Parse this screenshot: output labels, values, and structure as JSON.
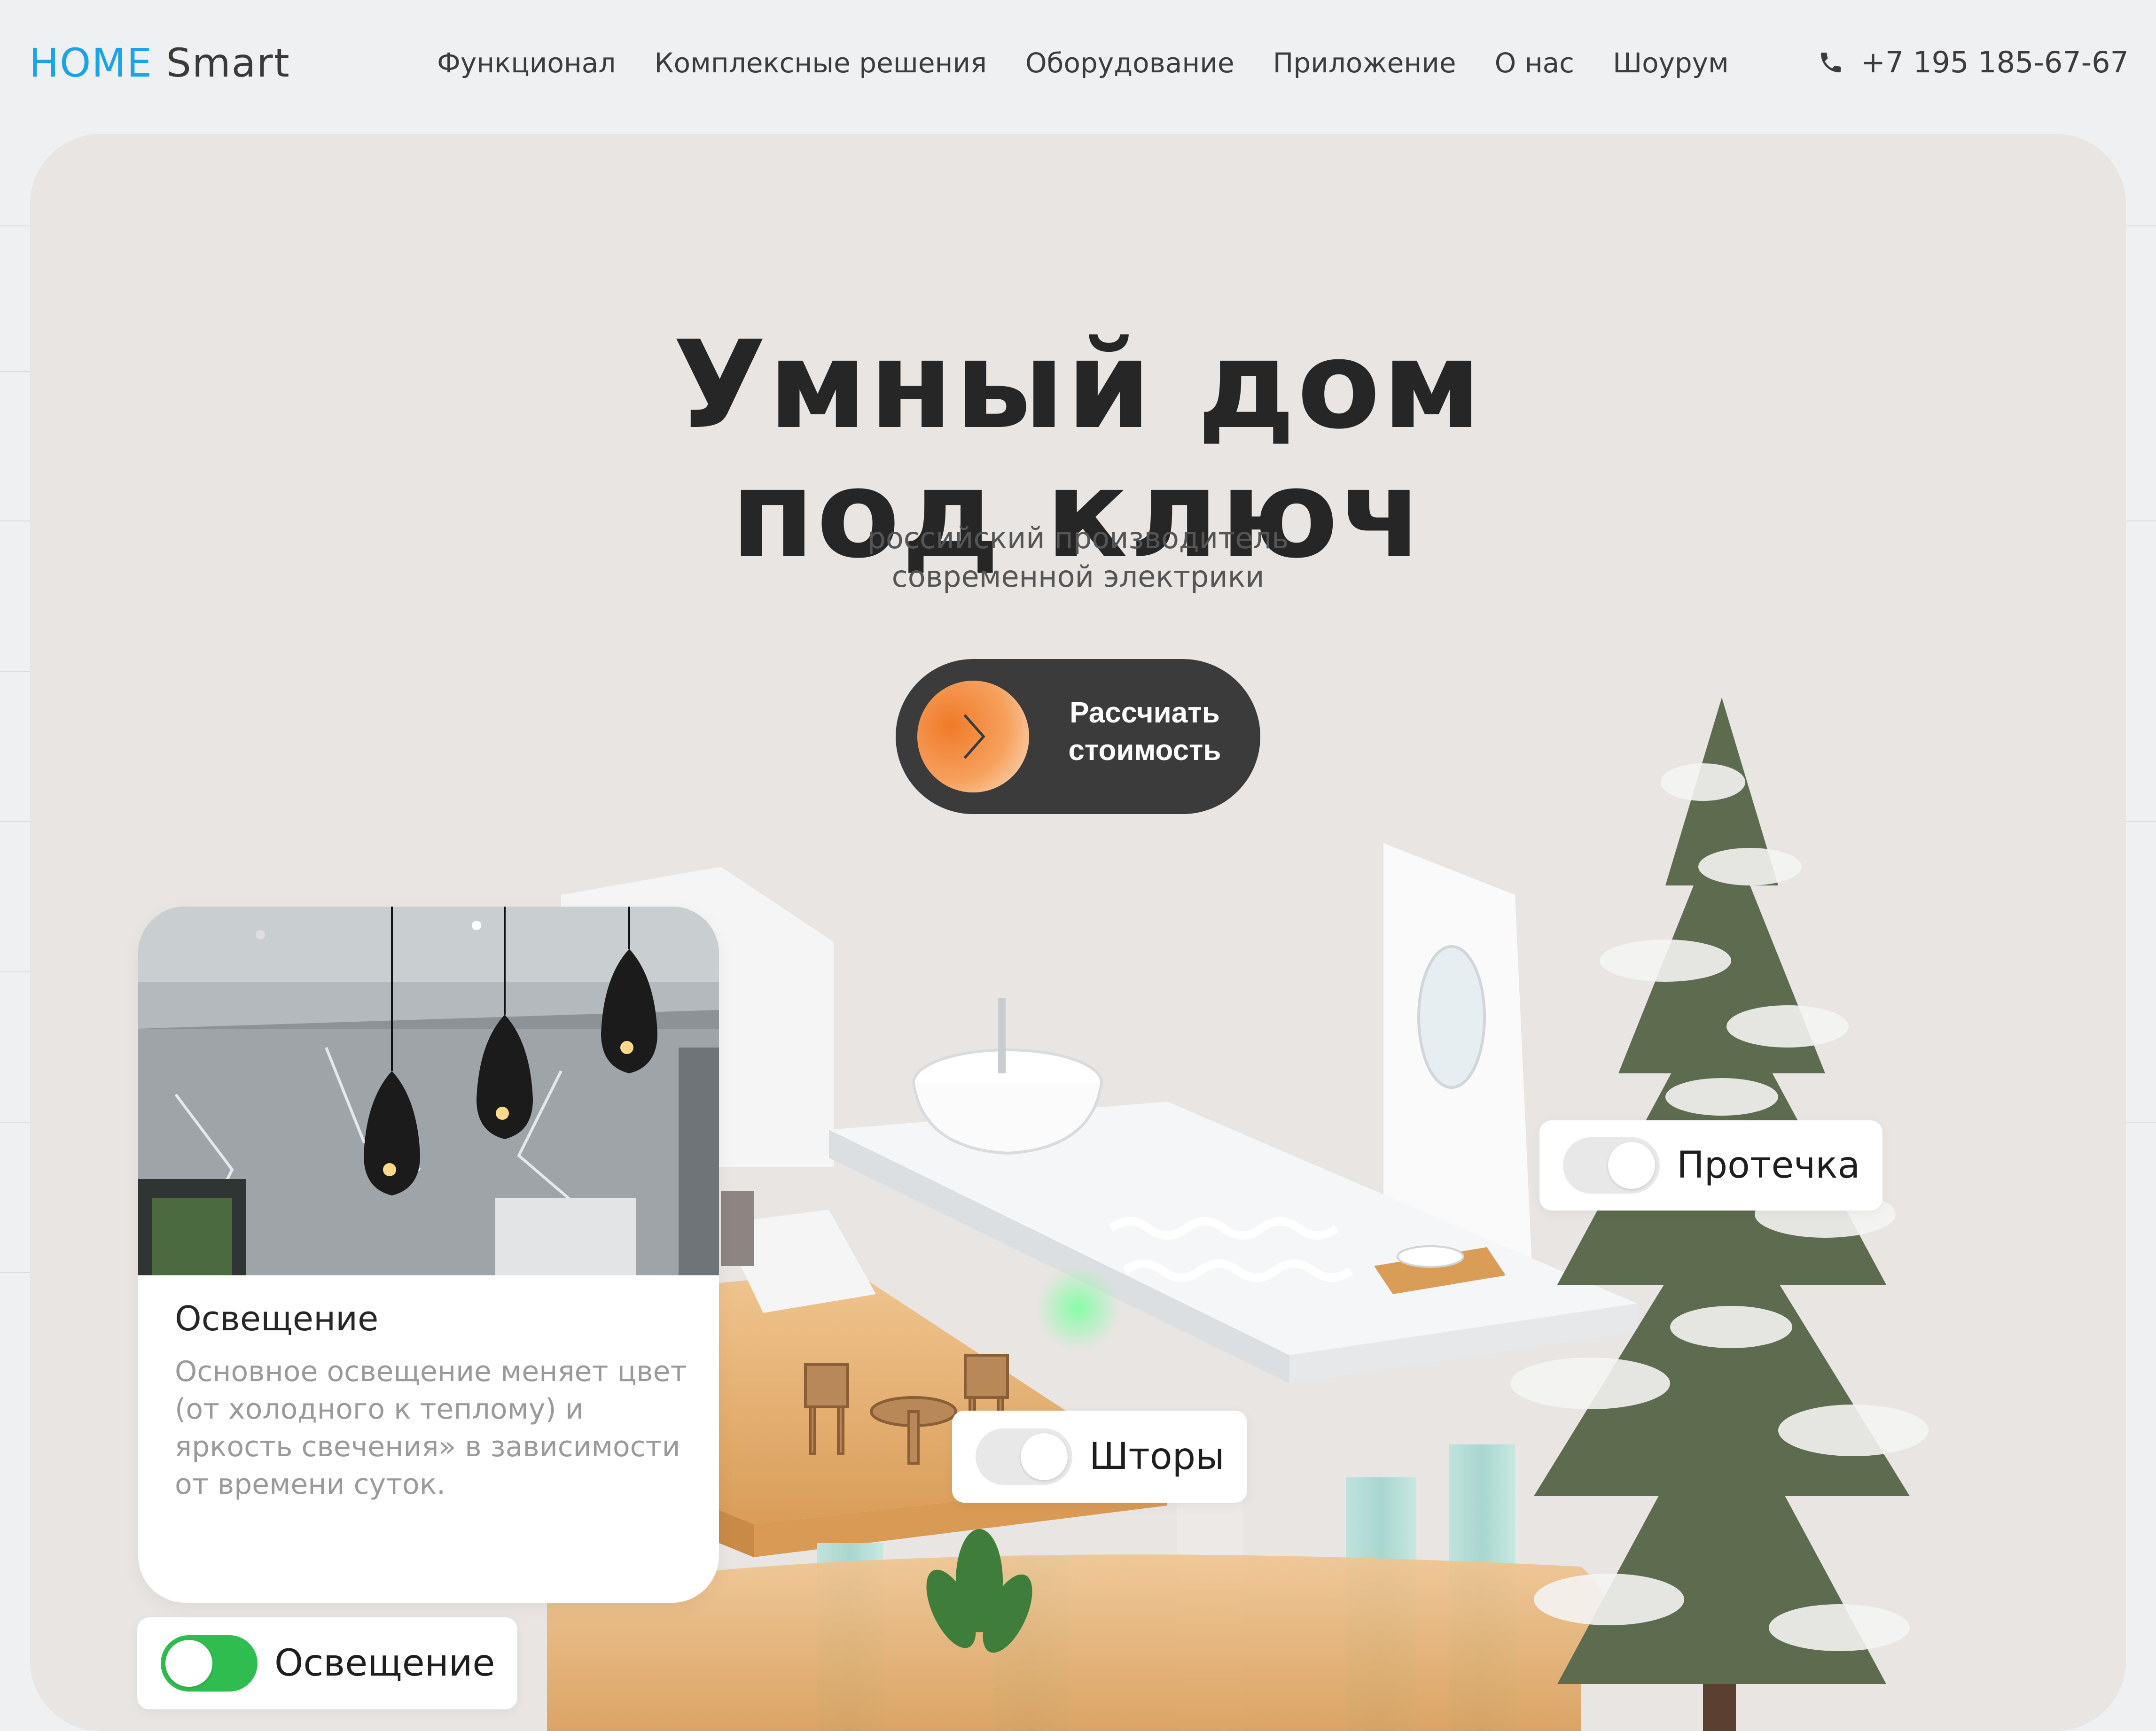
{
  "header": {
    "logo_home": "HOME",
    "logo_smart": "Smart",
    "nav": [
      "Функционал",
      "Комплексные решения",
      "Оборудование",
      "Приложение",
      "О нас",
      "Шоурум"
    ],
    "phone": "+7 195 185-67-67"
  },
  "hero": {
    "title_line1": "Умный дом",
    "title_line2": "под ключ",
    "subtitle_line1": "российский производитель",
    "subtitle_line2": "современной электрики",
    "cta_line1": "Рассчиать",
    "cta_line2": "стоимость"
  },
  "card": {
    "title": "Освещение",
    "text": "Основное освещение меняет цвет (от холодного к теплому) и яркость свечения» в зависимости от времени суток."
  },
  "toggles": {
    "leak": {
      "label": "Протечка",
      "state": "off"
    },
    "curtains": {
      "label": "Шторы",
      "state": "off"
    },
    "lighting": {
      "label": "Освещение",
      "state": "on"
    }
  },
  "colors": {
    "brand_blue": "#1aa3e8",
    "cta_dark": "#3b3b3b",
    "cta_orange": "#f07a2a",
    "toggle_on": "#2ebd4e"
  },
  "icons": {
    "phone": "phone-icon",
    "cta_arrow": "chevron-right-icon"
  }
}
